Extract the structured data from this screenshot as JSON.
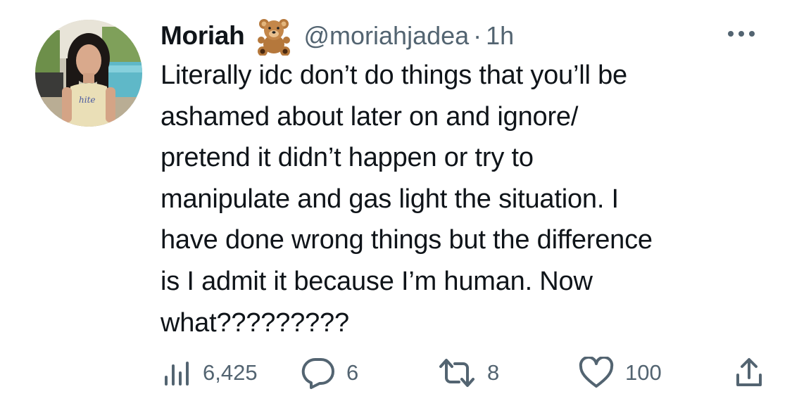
{
  "tweet": {
    "author_name": "Moriah",
    "author_emoji": "teddy-bear-emoji",
    "handle": "@moriahjadea",
    "separator": "·",
    "time": "1h",
    "text": "Literally idc don’t do things that you’ll be\nashamed about later on and ignore/\npretend it didn’t happen or try to\nmanipulate and gas light the situation. I\nhave done wrong things but the difference\nis I admit it because I’m human. Now\nwhat?????????",
    "views": "6,425",
    "replies": "6",
    "retweets": "8",
    "likes": "100"
  },
  "colors": {
    "text_primary": "#0f1419",
    "text_secondary": "#536471",
    "background": "#ffffff"
  }
}
